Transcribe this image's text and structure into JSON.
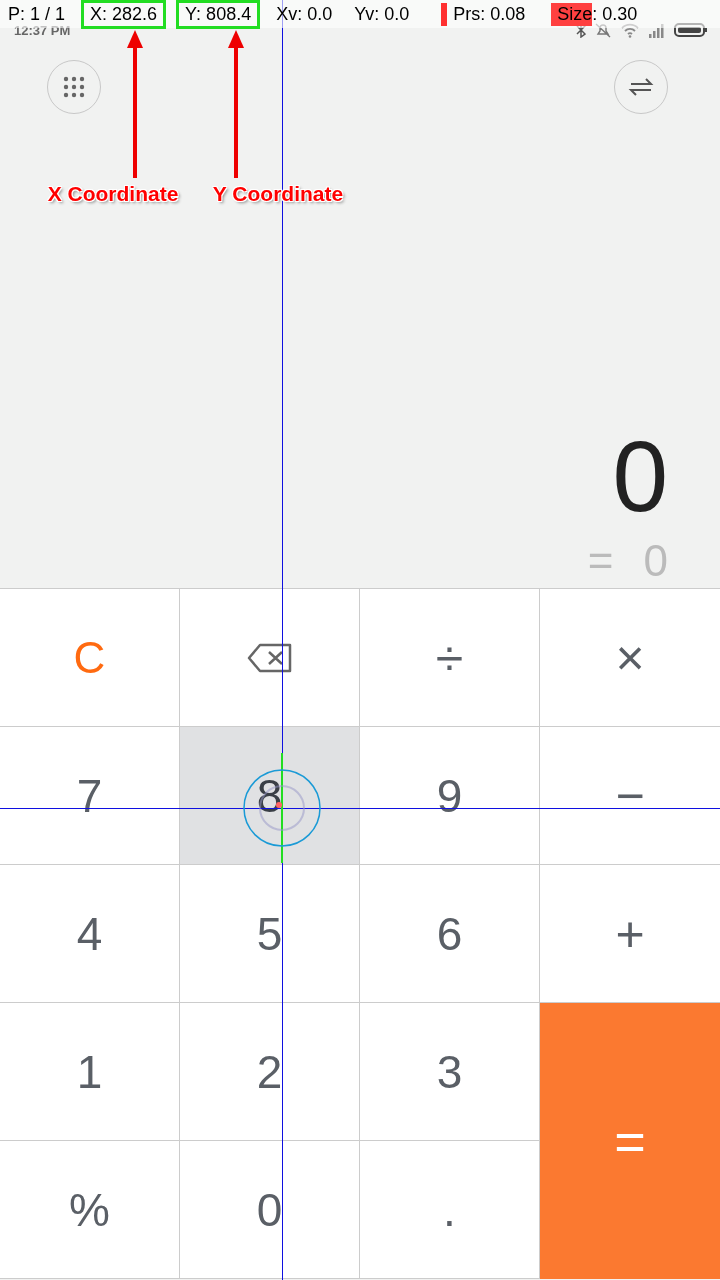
{
  "pointer_bar": {
    "items": [
      {
        "text": "P: 1 / 1",
        "kind": "plain"
      },
      {
        "text": "X: 282.6",
        "kind": "boxed"
      },
      {
        "text": "Y: 808.4",
        "kind": "boxed"
      },
      {
        "text": "Xv: 0.0",
        "kind": "plain"
      },
      {
        "text": "Yv: 0.0",
        "kind": "plain"
      },
      {
        "text": "Prs: 0.08",
        "kind": "bar"
      },
      {
        "text": "Size: 0.30",
        "kind": "fill"
      }
    ]
  },
  "status_bar": {
    "time": "12:37 PM"
  },
  "annotations": [
    {
      "label": "X Coordinate"
    },
    {
      "label": "Y Coordinate"
    }
  ],
  "display": {
    "expression": "0",
    "result_sign": "=",
    "result": "0"
  },
  "keys": [
    {
      "kind": "clear",
      "text": "C",
      "pressed": false
    },
    {
      "kind": "backspace",
      "pressed": false
    },
    {
      "kind": "operator",
      "text": "÷",
      "pressed": false
    },
    {
      "kind": "operator",
      "text": "×",
      "pressed": false
    },
    {
      "kind": "digit",
      "text": "7",
      "pressed": false
    },
    {
      "kind": "digit",
      "text": "8",
      "pressed": true
    },
    {
      "kind": "digit",
      "text": "9",
      "pressed": false
    },
    {
      "kind": "operator",
      "text": "−",
      "pressed": false
    },
    {
      "kind": "digit",
      "text": "4",
      "pressed": false
    },
    {
      "kind": "digit",
      "text": "5",
      "pressed": false
    },
    {
      "kind": "digit",
      "text": "6",
      "pressed": false
    },
    {
      "kind": "operator",
      "text": "+",
      "pressed": false
    },
    {
      "kind": "digit",
      "text": "1",
      "pressed": false
    },
    {
      "kind": "digit",
      "text": "2",
      "pressed": false
    },
    {
      "kind": "digit",
      "text": "3",
      "pressed": false
    },
    {
      "kind": "equals",
      "text": "=",
      "pressed": false
    },
    {
      "kind": "digit",
      "text": "%",
      "pressed": false
    },
    {
      "kind": "digit",
      "text": "0",
      "pressed": false
    },
    {
      "kind": "digit",
      "text": ".",
      "pressed": false
    }
  ]
}
